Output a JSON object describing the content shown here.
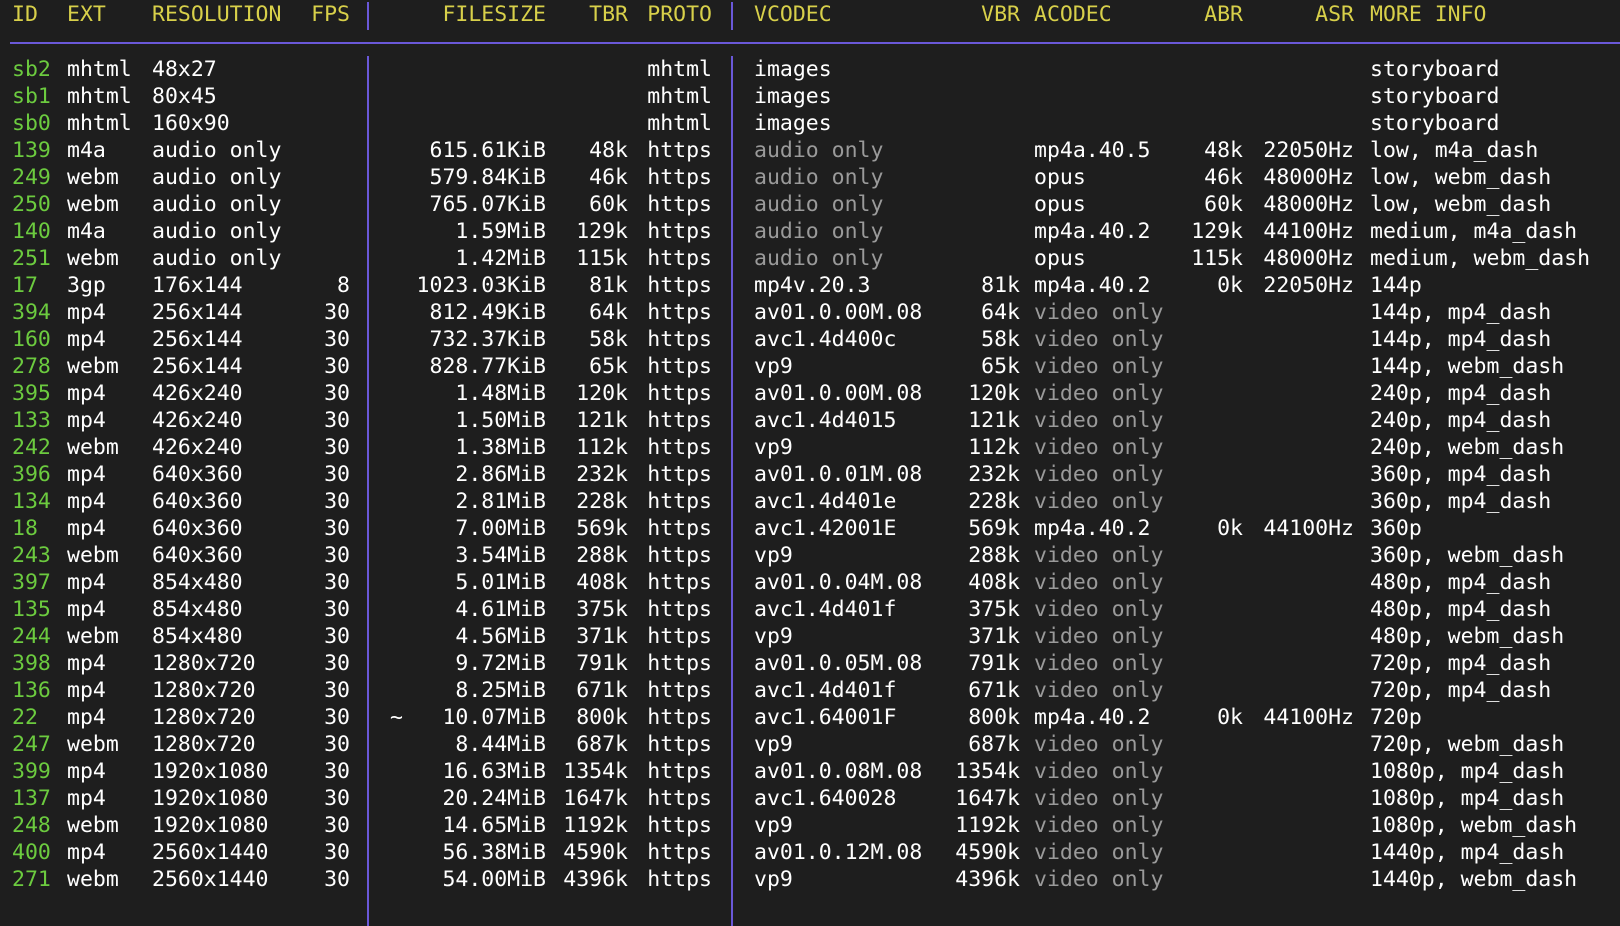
{
  "headers": {
    "id": "ID",
    "ext": "EXT",
    "resolution": "RESOLUTION",
    "fps": "FPS",
    "filesize": "FILESIZE",
    "tbr": "TBR",
    "proto": "PROTO",
    "vcodec": "VCODEC",
    "vbr": "VBR",
    "acodec": "ACODEC",
    "abr": "ABR",
    "asr": "ASR",
    "more": "MORE INFO"
  },
  "colors": {
    "background": "#1e1e1e",
    "header": "#d8d04a",
    "id": "#6ccb3f",
    "separator": "#6a58d8",
    "dim": "#9a9a9a"
  },
  "rows": [
    {
      "id": "sb2",
      "ext": "mhtml",
      "res": "48x27",
      "fps": "",
      "approx": "",
      "fs": "",
      "tbr": "",
      "proto": "mhtml",
      "vc": "images",
      "vbr": "",
      "ac": "",
      "abr": "",
      "asr": "",
      "more": "storyboard"
    },
    {
      "id": "sb1",
      "ext": "mhtml",
      "res": "80x45",
      "fps": "",
      "approx": "",
      "fs": "",
      "tbr": "",
      "proto": "mhtml",
      "vc": "images",
      "vbr": "",
      "ac": "",
      "abr": "",
      "asr": "",
      "more": "storyboard"
    },
    {
      "id": "sb0",
      "ext": "mhtml",
      "res": "160x90",
      "fps": "",
      "approx": "",
      "fs": "",
      "tbr": "",
      "proto": "mhtml",
      "vc": "images",
      "vbr": "",
      "ac": "",
      "abr": "",
      "asr": "",
      "more": "storyboard"
    },
    {
      "id": "139",
      "ext": "m4a",
      "res": "audio only",
      "fps": "",
      "approx": "",
      "fs": "615.61KiB",
      "tbr": "48k",
      "proto": "https",
      "vc": "audio only",
      "vbr": "",
      "ac": "mp4a.40.5",
      "abr": "48k",
      "asr": "22050Hz",
      "more": "low, m4a_dash"
    },
    {
      "id": "249",
      "ext": "webm",
      "res": "audio only",
      "fps": "",
      "approx": "",
      "fs": "579.84KiB",
      "tbr": "46k",
      "proto": "https",
      "vc": "audio only",
      "vbr": "",
      "ac": "opus",
      "abr": "46k",
      "asr": "48000Hz",
      "more": "low, webm_dash"
    },
    {
      "id": "250",
      "ext": "webm",
      "res": "audio only",
      "fps": "",
      "approx": "",
      "fs": "765.07KiB",
      "tbr": "60k",
      "proto": "https",
      "vc": "audio only",
      "vbr": "",
      "ac": "opus",
      "abr": "60k",
      "asr": "48000Hz",
      "more": "low, webm_dash"
    },
    {
      "id": "140",
      "ext": "m4a",
      "res": "audio only",
      "fps": "",
      "approx": "",
      "fs": "1.59MiB",
      "tbr": "129k",
      "proto": "https",
      "vc": "audio only",
      "vbr": "",
      "ac": "mp4a.40.2",
      "abr": "129k",
      "asr": "44100Hz",
      "more": "medium, m4a_dash"
    },
    {
      "id": "251",
      "ext": "webm",
      "res": "audio only",
      "fps": "",
      "approx": "",
      "fs": "1.42MiB",
      "tbr": "115k",
      "proto": "https",
      "vc": "audio only",
      "vbr": "",
      "ac": "opus",
      "abr": "115k",
      "asr": "48000Hz",
      "more": "medium, webm_dash"
    },
    {
      "id": "17",
      "ext": "3gp",
      "res": "176x144",
      "fps": "8",
      "approx": "",
      "fs": "1023.03KiB",
      "tbr": "81k",
      "proto": "https",
      "vc": "mp4v.20.3",
      "vbr": "81k",
      "ac": "mp4a.40.2",
      "abr": "0k",
      "asr": "22050Hz",
      "more": "144p"
    },
    {
      "id": "394",
      "ext": "mp4",
      "res": "256x144",
      "fps": "30",
      "approx": "",
      "fs": "812.49KiB",
      "tbr": "64k",
      "proto": "https",
      "vc": "av01.0.00M.08",
      "vbr": "64k",
      "ac": "video only",
      "abr": "",
      "asr": "",
      "more": "144p, mp4_dash"
    },
    {
      "id": "160",
      "ext": "mp4",
      "res": "256x144",
      "fps": "30",
      "approx": "",
      "fs": "732.37KiB",
      "tbr": "58k",
      "proto": "https",
      "vc": "avc1.4d400c",
      "vbr": "58k",
      "ac": "video only",
      "abr": "",
      "asr": "",
      "more": "144p, mp4_dash"
    },
    {
      "id": "278",
      "ext": "webm",
      "res": "256x144",
      "fps": "30",
      "approx": "",
      "fs": "828.77KiB",
      "tbr": "65k",
      "proto": "https",
      "vc": "vp9",
      "vbr": "65k",
      "ac": "video only",
      "abr": "",
      "asr": "",
      "more": "144p, webm_dash"
    },
    {
      "id": "395",
      "ext": "mp4",
      "res": "426x240",
      "fps": "30",
      "approx": "",
      "fs": "1.48MiB",
      "tbr": "120k",
      "proto": "https",
      "vc": "av01.0.00M.08",
      "vbr": "120k",
      "ac": "video only",
      "abr": "",
      "asr": "",
      "more": "240p, mp4_dash"
    },
    {
      "id": "133",
      "ext": "mp4",
      "res": "426x240",
      "fps": "30",
      "approx": "",
      "fs": "1.50MiB",
      "tbr": "121k",
      "proto": "https",
      "vc": "avc1.4d4015",
      "vbr": "121k",
      "ac": "video only",
      "abr": "",
      "asr": "",
      "more": "240p, mp4_dash"
    },
    {
      "id": "242",
      "ext": "webm",
      "res": "426x240",
      "fps": "30",
      "approx": "",
      "fs": "1.38MiB",
      "tbr": "112k",
      "proto": "https",
      "vc": "vp9",
      "vbr": "112k",
      "ac": "video only",
      "abr": "",
      "asr": "",
      "more": "240p, webm_dash"
    },
    {
      "id": "396",
      "ext": "mp4",
      "res": "640x360",
      "fps": "30",
      "approx": "",
      "fs": "2.86MiB",
      "tbr": "232k",
      "proto": "https",
      "vc": "av01.0.01M.08",
      "vbr": "232k",
      "ac": "video only",
      "abr": "",
      "asr": "",
      "more": "360p, mp4_dash"
    },
    {
      "id": "134",
      "ext": "mp4",
      "res": "640x360",
      "fps": "30",
      "approx": "",
      "fs": "2.81MiB",
      "tbr": "228k",
      "proto": "https",
      "vc": "avc1.4d401e",
      "vbr": "228k",
      "ac": "video only",
      "abr": "",
      "asr": "",
      "more": "360p, mp4_dash"
    },
    {
      "id": "18",
      "ext": "mp4",
      "res": "640x360",
      "fps": "30",
      "approx": "",
      "fs": "7.00MiB",
      "tbr": "569k",
      "proto": "https",
      "vc": "avc1.42001E",
      "vbr": "569k",
      "ac": "mp4a.40.2",
      "abr": "0k",
      "asr": "44100Hz",
      "more": "360p"
    },
    {
      "id": "243",
      "ext": "webm",
      "res": "640x360",
      "fps": "30",
      "approx": "",
      "fs": "3.54MiB",
      "tbr": "288k",
      "proto": "https",
      "vc": "vp9",
      "vbr": "288k",
      "ac": "video only",
      "abr": "",
      "asr": "",
      "more": "360p, webm_dash"
    },
    {
      "id": "397",
      "ext": "mp4",
      "res": "854x480",
      "fps": "30",
      "approx": "",
      "fs": "5.01MiB",
      "tbr": "408k",
      "proto": "https",
      "vc": "av01.0.04M.08",
      "vbr": "408k",
      "ac": "video only",
      "abr": "",
      "asr": "",
      "more": "480p, mp4_dash"
    },
    {
      "id": "135",
      "ext": "mp4",
      "res": "854x480",
      "fps": "30",
      "approx": "",
      "fs": "4.61MiB",
      "tbr": "375k",
      "proto": "https",
      "vc": "avc1.4d401f",
      "vbr": "375k",
      "ac": "video only",
      "abr": "",
      "asr": "",
      "more": "480p, mp4_dash"
    },
    {
      "id": "244",
      "ext": "webm",
      "res": "854x480",
      "fps": "30",
      "approx": "",
      "fs": "4.56MiB",
      "tbr": "371k",
      "proto": "https",
      "vc": "vp9",
      "vbr": "371k",
      "ac": "video only",
      "abr": "",
      "asr": "",
      "more": "480p, webm_dash"
    },
    {
      "id": "398",
      "ext": "mp4",
      "res": "1280x720",
      "fps": "30",
      "approx": "",
      "fs": "9.72MiB",
      "tbr": "791k",
      "proto": "https",
      "vc": "av01.0.05M.08",
      "vbr": "791k",
      "ac": "video only",
      "abr": "",
      "asr": "",
      "more": "720p, mp4_dash"
    },
    {
      "id": "136",
      "ext": "mp4",
      "res": "1280x720",
      "fps": "30",
      "approx": "",
      "fs": "8.25MiB",
      "tbr": "671k",
      "proto": "https",
      "vc": "avc1.4d401f",
      "vbr": "671k",
      "ac": "video only",
      "abr": "",
      "asr": "",
      "more": "720p, mp4_dash"
    },
    {
      "id": "22",
      "ext": "mp4",
      "res": "1280x720",
      "fps": "30",
      "approx": "~",
      "fs": "10.07MiB",
      "tbr": "800k",
      "proto": "https",
      "vc": "avc1.64001F",
      "vbr": "800k",
      "ac": "mp4a.40.2",
      "abr": "0k",
      "asr": "44100Hz",
      "more": "720p"
    },
    {
      "id": "247",
      "ext": "webm",
      "res": "1280x720",
      "fps": "30",
      "approx": "",
      "fs": "8.44MiB",
      "tbr": "687k",
      "proto": "https",
      "vc": "vp9",
      "vbr": "687k",
      "ac": "video only",
      "abr": "",
      "asr": "",
      "more": "720p, webm_dash"
    },
    {
      "id": "399",
      "ext": "mp4",
      "res": "1920x1080",
      "fps": "30",
      "approx": "",
      "fs": "16.63MiB",
      "tbr": "1354k",
      "proto": "https",
      "vc": "av01.0.08M.08",
      "vbr": "1354k",
      "ac": "video only",
      "abr": "",
      "asr": "",
      "more": "1080p, mp4_dash"
    },
    {
      "id": "137",
      "ext": "mp4",
      "res": "1920x1080",
      "fps": "30",
      "approx": "",
      "fs": "20.24MiB",
      "tbr": "1647k",
      "proto": "https",
      "vc": "avc1.640028",
      "vbr": "1647k",
      "ac": "video only",
      "abr": "",
      "asr": "",
      "more": "1080p, mp4_dash"
    },
    {
      "id": "248",
      "ext": "webm",
      "res": "1920x1080",
      "fps": "30",
      "approx": "",
      "fs": "14.65MiB",
      "tbr": "1192k",
      "proto": "https",
      "vc": "vp9",
      "vbr": "1192k",
      "ac": "video only",
      "abr": "",
      "asr": "",
      "more": "1080p, webm_dash"
    },
    {
      "id": "400",
      "ext": "mp4",
      "res": "2560x1440",
      "fps": "30",
      "approx": "",
      "fs": "56.38MiB",
      "tbr": "4590k",
      "proto": "https",
      "vc": "av01.0.12M.08",
      "vbr": "4590k",
      "ac": "video only",
      "abr": "",
      "asr": "",
      "more": "1440p, mp4_dash"
    },
    {
      "id": "271",
      "ext": "webm",
      "res": "2560x1440",
      "fps": "30",
      "approx": "",
      "fs": "54.00MiB",
      "tbr": "4396k",
      "proto": "https",
      "vc": "vp9",
      "vbr": "4396k",
      "ac": "video only",
      "abr": "",
      "asr": "",
      "more": "1440p, webm_dash"
    }
  ]
}
